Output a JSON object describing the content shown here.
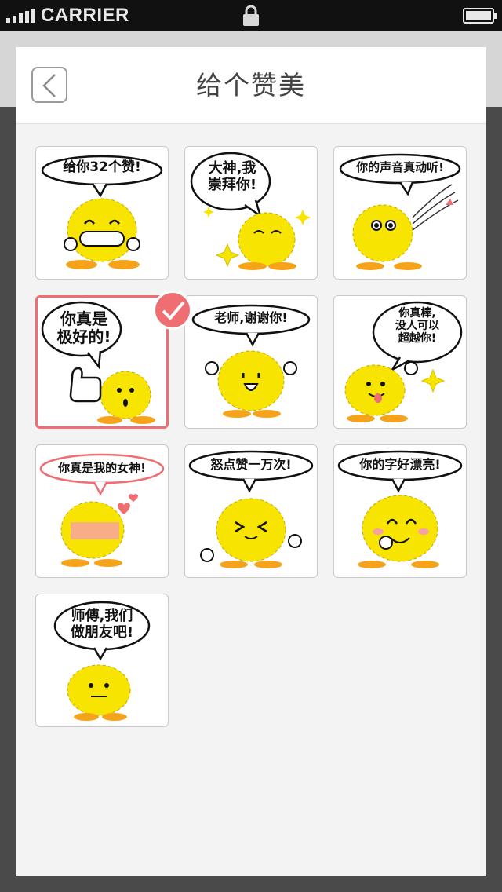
{
  "status_bar": {
    "carrier": "CARRIER",
    "signal_icon": "signal-bars-icon",
    "lock_icon": "lock-icon",
    "battery_icon": "battery-icon"
  },
  "dialog": {
    "title": "给个赞美",
    "back_icon": "chevron-left-icon",
    "selected_index": 3,
    "accent_color": "#ee6e72"
  },
  "stickers": [
    {
      "caption": "给你32个赞!"
    },
    {
      "caption": "大神,我\n崇拜你!"
    },
    {
      "caption": "你的声音真动听!"
    },
    {
      "caption": "你真是\n极好的!"
    },
    {
      "caption": "老师,谢谢你!"
    },
    {
      "caption": "你真棒,\n没人可以\n超越你!"
    },
    {
      "caption": "你真是我的女神!"
    },
    {
      "caption": "怒点赞一万次!"
    },
    {
      "caption": "你的字好漂亮!"
    },
    {
      "caption": "师傅,我们\n做朋友吧!"
    }
  ],
  "colors": {
    "mascot_yellow": "#f7e400",
    "feet_orange": "#f5a31a",
    "heart_pink": "#ee6e72",
    "blush_pink": "#f6a0a8"
  }
}
